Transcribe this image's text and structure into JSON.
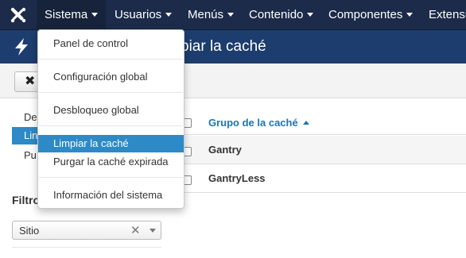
{
  "navbar": {
    "logo_icon": "joomla-logo-icon",
    "items": [
      {
        "label": "Sistema",
        "has_caret": true
      },
      {
        "label": "Usuarios",
        "has_caret": true
      },
      {
        "label": "Menús",
        "has_caret": true
      },
      {
        "label": "Contenido",
        "has_caret": true
      },
      {
        "label": "Componentes",
        "has_caret": true
      },
      {
        "label": "Extensi",
        "has_caret": false
      }
    ]
  },
  "titlebar": {
    "icon": "lightning-icon",
    "title": "piar la caché"
  },
  "toolbar": {
    "close_icon": "close-icon",
    "close_label": "✖"
  },
  "sidebar": {
    "items": [
      {
        "label": "De",
        "active": false
      },
      {
        "label": "Lin",
        "active": true
      },
      {
        "label": "Pu",
        "active": false
      }
    ]
  },
  "filters": {
    "heading": "Filtro",
    "site_select": {
      "value": "Sitio",
      "clear": "✕"
    }
  },
  "table": {
    "header": "Grupo de la caché",
    "sort": "ascending",
    "rows": [
      "Gantry",
      "GantryLess"
    ]
  },
  "dropdown": {
    "items": [
      {
        "label": "Panel de control",
        "active": false
      },
      {
        "label": "Configuración global",
        "active": false
      },
      {
        "label": "Desbloqueo global",
        "active": false
      },
      {
        "label": "Limpiar la caché",
        "active": true
      },
      {
        "label": "Purgar la caché expirada",
        "active": false
      },
      {
        "label": "Información del sistema",
        "active": false
      }
    ]
  },
  "colors": {
    "navbar_bg": "#1b2b49",
    "titlebar_bg": "#1c3d6e",
    "accent_active": "#2d8ac7",
    "link": "#1b74b8"
  }
}
